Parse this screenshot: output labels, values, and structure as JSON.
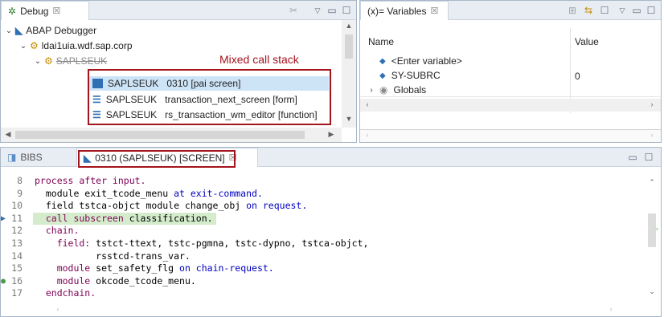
{
  "debug_view": {
    "tab_label": "Debug",
    "tab_close": "☒",
    "tree": {
      "root": "ABAP Debugger",
      "host": "ldai1uia.wdf.sap.corp",
      "session": "SAPLSEUK",
      "annotation": "Mixed call stack",
      "frames": [
        {
          "program": "SAPLSEUK",
          "detail": "0310 [pai screen]"
        },
        {
          "program": "SAPLSEUK",
          "detail": "transaction_next_screen [form]"
        },
        {
          "program": "SAPLSEUK",
          "detail": "rs_transaction_wm_editor [function]"
        }
      ]
    }
  },
  "variables_view": {
    "tab_label": "(x)= Variables",
    "tab_close": "☒",
    "col_name": "Name",
    "col_value": "Value",
    "rows": [
      {
        "name": "<Enter variable>",
        "value": ""
      },
      {
        "name": "SY-SUBRC",
        "value": "0"
      },
      {
        "name": "Globals",
        "value": ""
      }
    ]
  },
  "editor": {
    "tab_inactive": "BIBS",
    "tab_active": "0310 (SAPLSEUK) [SCREEN]",
    "tab_close": "☒",
    "lines": [
      {
        "num": "8",
        "marker": "",
        "highlight": false,
        "segments": [
          {
            "t": "process after input.",
            "c": "kw"
          }
        ]
      },
      {
        "num": "9",
        "marker": "",
        "highlight": false,
        "segments": [
          {
            "t": "  module exit_tcode_menu ",
            "c": "plain"
          },
          {
            "t": "at exit-command.",
            "c": "kwb"
          }
        ]
      },
      {
        "num": "10",
        "marker": "",
        "highlight": false,
        "segments": [
          {
            "t": "  field tstca-objct module change_obj ",
            "c": "plain"
          },
          {
            "t": "on request.",
            "c": "kwb"
          }
        ]
      },
      {
        "num": "11",
        "marker": "arrow",
        "highlight": true,
        "segments": [
          {
            "t": "  call subscreen ",
            "c": "kw"
          },
          {
            "t": "classification.",
            "c": "plain"
          }
        ]
      },
      {
        "num": "12",
        "marker": "",
        "highlight": false,
        "segments": [
          {
            "t": "  chain.",
            "c": "kw"
          }
        ]
      },
      {
        "num": "13",
        "marker": "",
        "highlight": false,
        "segments": [
          {
            "t": "    field: ",
            "c": "kw"
          },
          {
            "t": "tstct-ttext, tstc-pgmna, tstc-dypno, tstca-objct,",
            "c": "plain"
          }
        ]
      },
      {
        "num": "14",
        "marker": "",
        "highlight": false,
        "segments": [
          {
            "t": "           rsstcd-trans_var.",
            "c": "plain"
          }
        ]
      },
      {
        "num": "15",
        "marker": "",
        "highlight": false,
        "segments": [
          {
            "t": "    module ",
            "c": "kw"
          },
          {
            "t": "set_safety_flg ",
            "c": "plain"
          },
          {
            "t": "on chain-request.",
            "c": "kwb"
          }
        ]
      },
      {
        "num": "16",
        "marker": "bp",
        "highlight": false,
        "segments": [
          {
            "t": "    module ",
            "c": "kw"
          },
          {
            "t": "okcode_tcode_menu.",
            "c": "plain"
          }
        ]
      },
      {
        "num": "17",
        "marker": "",
        "highlight": false,
        "segments": [
          {
            "t": "  endchain.",
            "c": "kw"
          }
        ]
      }
    ]
  },
  "colors": {
    "panel_border": "#a8b7c8",
    "tabbar_bg": "#e8edf3",
    "highlight_line": "#d4eccc",
    "annotation_red": "#a3141d",
    "keyword": "#7f0055"
  }
}
